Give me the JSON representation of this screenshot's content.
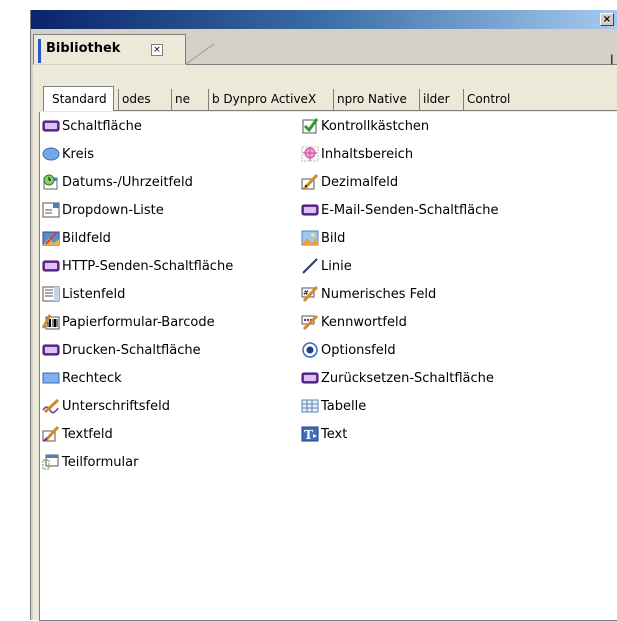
{
  "window": {
    "close_glyph": "×"
  },
  "panel": {
    "title": "Bibliothek",
    "close_glyph": "×",
    "right_tab_fragment": "|"
  },
  "tabs": [
    {
      "label": "Standard",
      "active": true
    },
    {
      "label": "odes",
      "active": false
    },
    {
      "label": "ne",
      "active": false
    },
    {
      "label": "b Dynpro ActiveX",
      "active": false
    },
    {
      "label": "npro Native",
      "active": false
    },
    {
      "label": "ilder",
      "active": false
    },
    {
      "label": "Control",
      "active": false
    }
  ],
  "items_left": [
    {
      "label": "Schaltfläche",
      "icon": "button-icon"
    },
    {
      "label": "Kreis",
      "icon": "circle-icon"
    },
    {
      "label": "Datums-/Uhrzeitfeld",
      "icon": "datetime-icon"
    },
    {
      "label": "Dropdown-Liste",
      "icon": "dropdown-icon"
    },
    {
      "label": "Bildfeld",
      "icon": "imagefield-icon"
    },
    {
      "label": "HTTP-Senden-Schaltfläche",
      "icon": "button-icon"
    },
    {
      "label": "Listenfeld",
      "icon": "listbox-icon"
    },
    {
      "label": "Papierformular-Barcode",
      "icon": "barcode-icon"
    },
    {
      "label": "Drucken-Schaltfläche",
      "icon": "button-icon"
    },
    {
      "label": "Rechteck",
      "icon": "rectangle-icon"
    },
    {
      "label": "Unterschriftsfeld",
      "icon": "signature-icon"
    },
    {
      "label": "Textfeld",
      "icon": "textfield-icon"
    },
    {
      "label": "Teilformular",
      "icon": "subform-icon"
    }
  ],
  "items_right": [
    {
      "label": "Kontrollkästchen",
      "icon": "checkbox-icon"
    },
    {
      "label": "Inhaltsbereich",
      "icon": "contentarea-icon"
    },
    {
      "label": "Dezimalfeld",
      "icon": "decimal-icon"
    },
    {
      "label": "E-Mail-Senden-Schaltfläche",
      "icon": "button-icon"
    },
    {
      "label": "Bild",
      "icon": "image-icon"
    },
    {
      "label": "Linie",
      "icon": "line-icon"
    },
    {
      "label": "Numerisches Feld",
      "icon": "numeric-icon"
    },
    {
      "label": "Kennwortfeld",
      "icon": "password-icon"
    },
    {
      "label": "Optionsfeld",
      "icon": "radio-icon"
    },
    {
      "label": "Zurücksetzen-Schaltfläche",
      "icon": "button-icon"
    },
    {
      "label": "Tabelle",
      "icon": "table-icon"
    },
    {
      "label": "Text",
      "icon": "text-icon"
    }
  ]
}
